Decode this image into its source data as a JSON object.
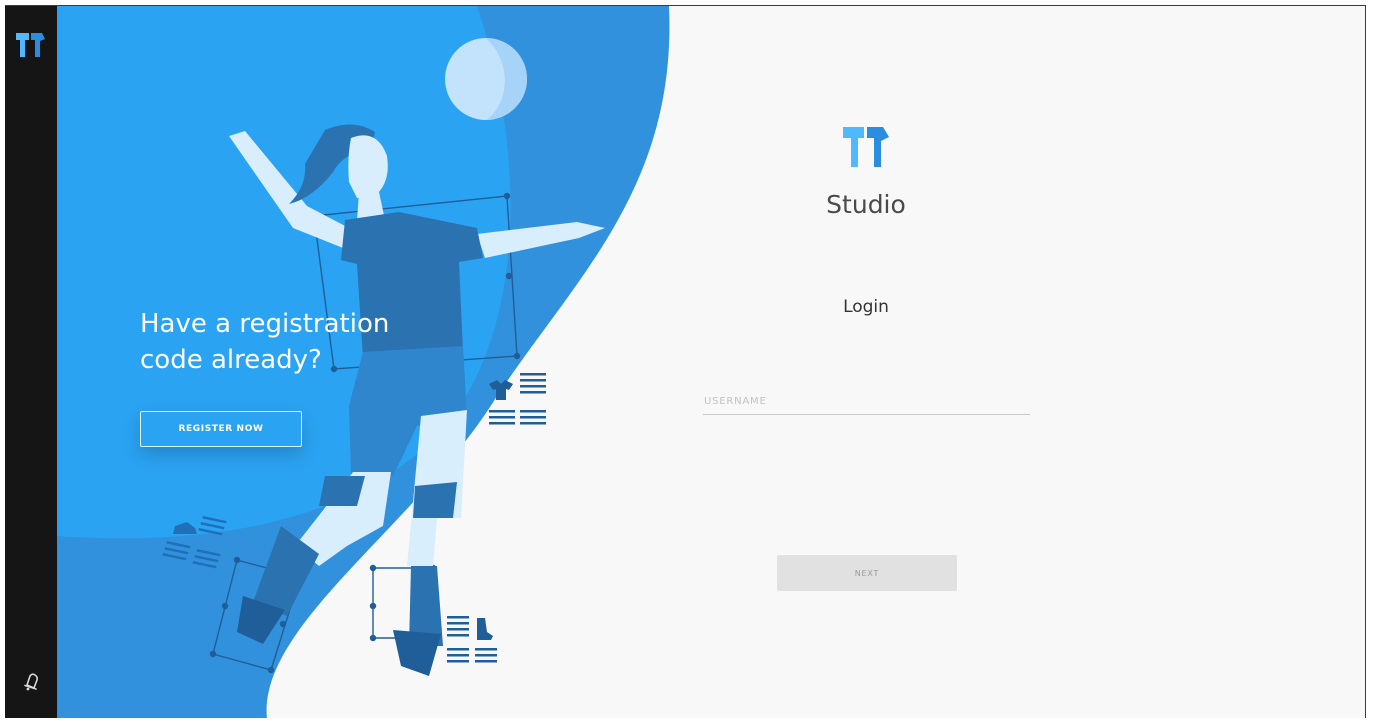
{
  "sidebar": {
    "logo_icon": "app-logo-icon",
    "bottom_icon": "notification-bell-icon"
  },
  "hero": {
    "title": "Have a registration\ncode already?",
    "register_label": "REGISTER NOW"
  },
  "login": {
    "app_name": "Studio",
    "heading": "Login",
    "username_placeholder": "USERNAME",
    "username_value": "",
    "next_label": "NEXT"
  },
  "colors": {
    "sidebar_bg": "#151515",
    "hero_blue": "#2aa3f3",
    "hero_blue_dark": "#3291dc",
    "figure_dark": "#2b72b1",
    "panel_bg": "#f8f8f8",
    "next_button_bg": "#e1e1e1"
  }
}
